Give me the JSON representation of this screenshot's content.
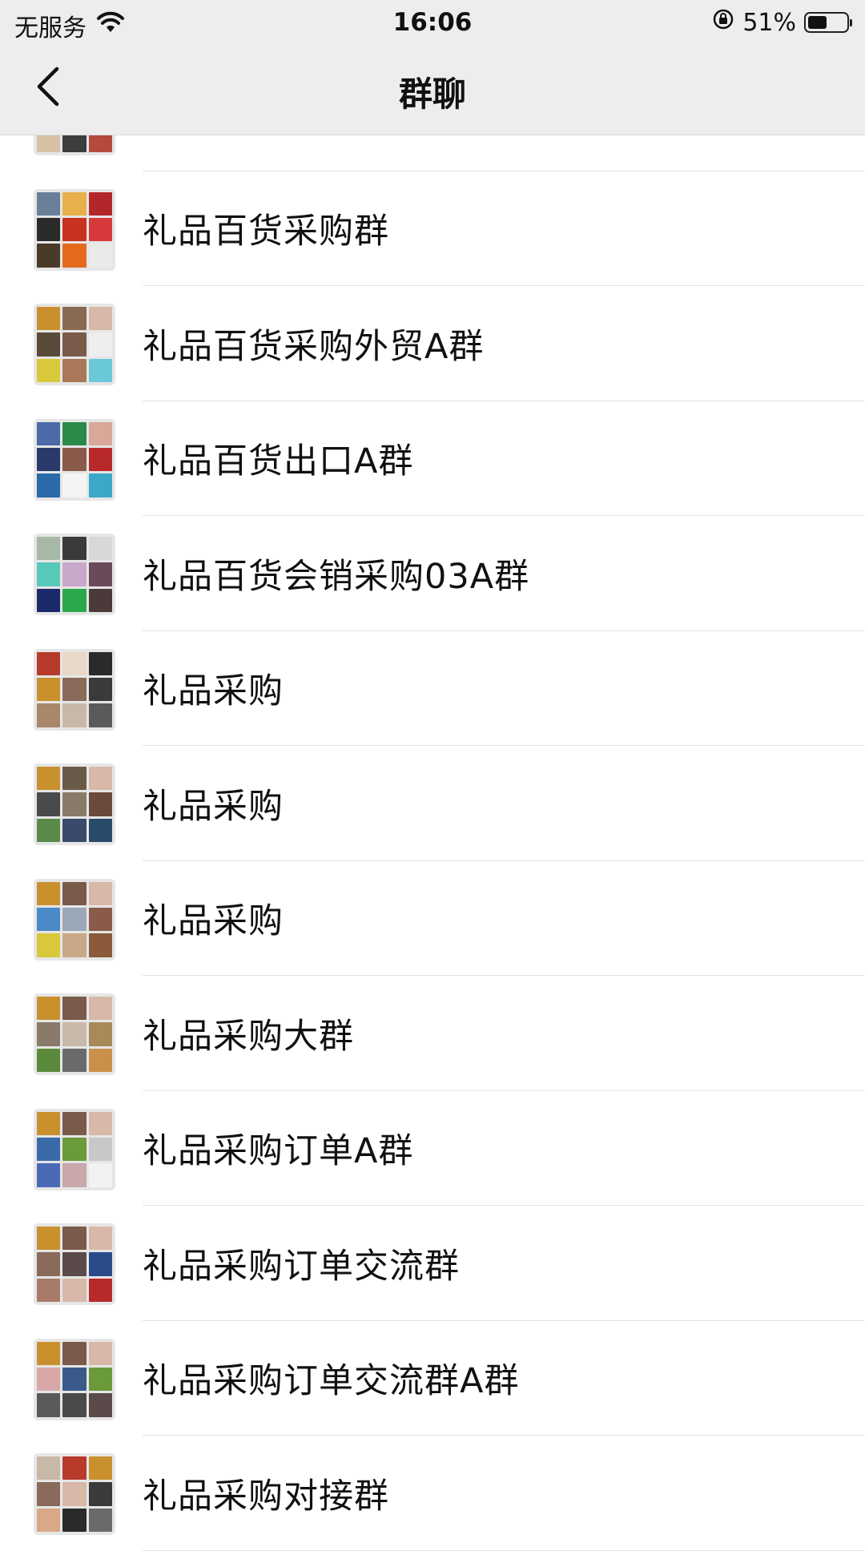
{
  "status_bar": {
    "carrier": "无服务",
    "wifi_icon": "wifi-icon",
    "time": "16:06",
    "rotation_lock_icon": "rotation-lock-icon",
    "battery_percent": "51%",
    "battery_level": 0.51
  },
  "nav": {
    "back_icon": "chevron-left-icon",
    "title": "群聊"
  },
  "groups": [
    {
      "name": "",
      "colors": [
        "#c9a98a",
        "#5b6b8a",
        "#7a2b22",
        "#e8d6c0",
        "#f2d43c",
        "#8f1d1a",
        "#d8c2a6",
        "#3d3d3d",
        "#b34a3a"
      ]
    },
    {
      "name": "礼品百货采购群",
      "colors": [
        "#6b7f99",
        "#e8b04a",
        "#b3262a",
        "#2b2b2b",
        "#c8321f",
        "#d63a3a",
        "#4a3a2a",
        "#e36a1d",
        "#eaeaea"
      ]
    },
    {
      "name": "礼品百货采购外贸A群",
      "colors": [
        "#c9902e",
        "#8a6a52",
        "#d8b8a8",
        "#5a4a3a",
        "#7a5a4a",
        "#eeeeee",
        "#d8c83a",
        "#a87858",
        "#6ac8d8"
      ]
    },
    {
      "name": "礼品百货出口A群",
      "colors": [
        "#4a6aa8",
        "#2a8a4a",
        "#d8a898",
        "#2a3a6a",
        "#8a5a4a",
        "#b82a2a",
        "#2a6aa8",
        "#f4f4f4",
        "#3aa8c8"
      ]
    },
    {
      "name": "礼品百货会销采购03A群",
      "colors": [
        "#a8b8a8",
        "#3a3a3a",
        "#d8d8d8",
        "#58c8b8",
        "#c8a8c8",
        "#6a4a5a",
        "#1a2a6a",
        "#2aa84a",
        "#4a3a3a"
      ]
    },
    {
      "name": "礼品采购",
      "colors": [
        "#b83a2a",
        "#e8d8c8",
        "#2a2a2a",
        "#c9902e",
        "#8a6a5a",
        "#3a3a3a",
        "#a88868",
        "#c8b8a8",
        "#5a5a5a"
      ]
    },
    {
      "name": "礼品采购",
      "colors": [
        "#c9902e",
        "#6a5a4a",
        "#d8b8a8",
        "#4a4a4a",
        "#8a7a6a",
        "#6a4a3a",
        "#5a8a4a",
        "#3a4a6a",
        "#2a4a6a"
      ]
    },
    {
      "name": "礼品采购",
      "colors": [
        "#c9902e",
        "#7a5a4a",
        "#d8b8a8",
        "#4a8ac8",
        "#9aa8b8",
        "#8a5a4a",
        "#d8c83a",
        "#c8a888",
        "#8a5a3a"
      ]
    },
    {
      "name": "礼品采购大群",
      "colors": [
        "#c9902e",
        "#7a5a4a",
        "#d8b8a8",
        "#8a7a6a",
        "#c8b8a8",
        "#a88a5a",
        "#5a8a3a",
        "#6a6a6a",
        "#c8904a"
      ]
    },
    {
      "name": "礼品采购订单A群",
      "colors": [
        "#c9902e",
        "#7a5a4a",
        "#d8b8a8",
        "#3a6aa8",
        "#6a9a3a",
        "#c8c8c8",
        "#4a6ab8",
        "#c8a8a8",
        "#f2f2f2"
      ]
    },
    {
      "name": "礼品采购订单交流群",
      "colors": [
        "#c9902e",
        "#7a5a4a",
        "#d8b8a8",
        "#8a6a5a",
        "#5a4a4a",
        "#2a4a8a",
        "#a87a6a",
        "#d8b8a8",
        "#b82a2a"
      ]
    },
    {
      "name": "礼品采购订单交流群A群",
      "colors": [
        "#c9902e",
        "#7a5a4a",
        "#d8b8a8",
        "#d8a8a8",
        "#3a5a8a",
        "#6a9a3a",
        "#5a5a5a",
        "#4a4a4a",
        "#5a4a4a"
      ]
    },
    {
      "name": "礼品采购对接群",
      "colors": [
        "#c8b8a8",
        "#b83a2a",
        "#c9902e",
        "#8a6a5a",
        "#d8b8a8",
        "#3a3a3a",
        "#d8a888",
        "#2a2a2a",
        "#6a6a6a"
      ]
    }
  ],
  "colors": {
    "header_bg": "#ededed",
    "list_bg": "#ffffff",
    "divider": "#e3e3e3",
    "text": "#111111"
  }
}
